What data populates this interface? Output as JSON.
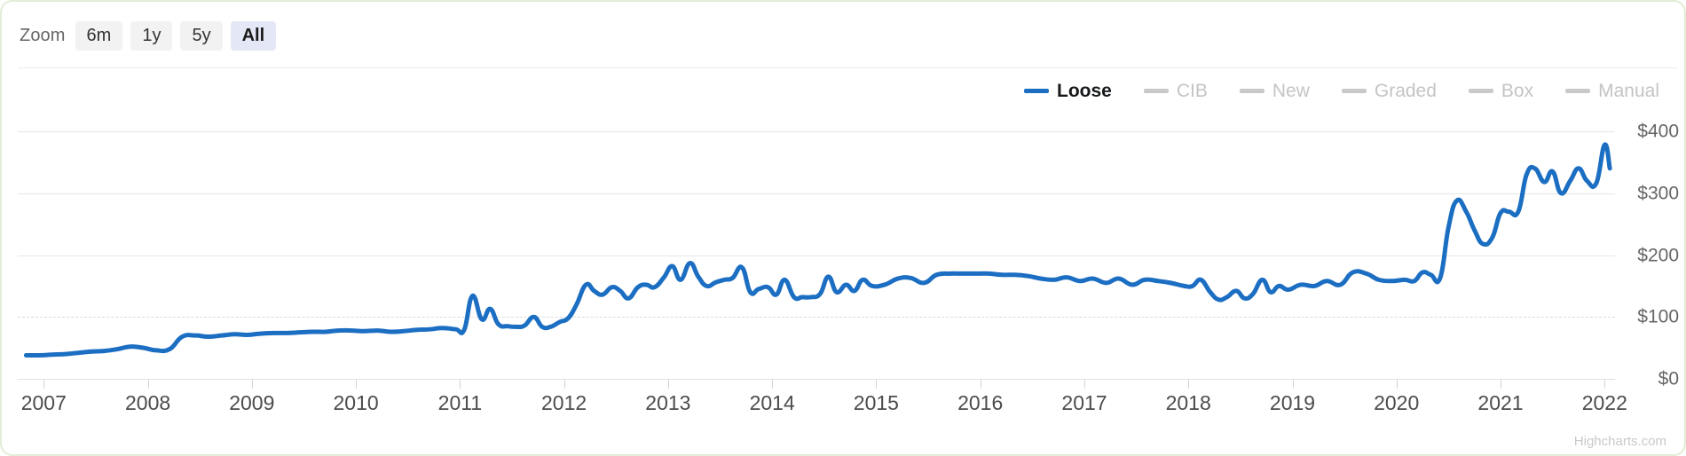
{
  "toolbar": {
    "zoom_label": "Zoom",
    "buttons": [
      {
        "label": "6m",
        "active": false
      },
      {
        "label": "1y",
        "active": false
      },
      {
        "label": "5y",
        "active": false
      },
      {
        "label": "All",
        "active": true
      }
    ]
  },
  "colors": {
    "active_series": "#1b6ec2",
    "inactive_series": "#c9c9c9",
    "grid": "#e6e6e6",
    "frame": "#e3ecd5"
  },
  "credits": "Highcharts.com",
  "chart_data": {
    "type": "line",
    "title": "",
    "subtitle": "",
    "xlabel": "",
    "ylabel": "",
    "grid": true,
    "legend_position": "top-right",
    "xlim": [
      2006.75,
      2022.1
    ],
    "ylim": [
      0,
      430
    ],
    "x_tick_labels": [
      "2007",
      "2008",
      "2009",
      "2010",
      "2011",
      "2012",
      "2013",
      "2014",
      "2015",
      "2016",
      "2017",
      "2018",
      "2019",
      "2020",
      "2021",
      "2022"
    ],
    "x_ticks": [
      2007,
      2008,
      2009,
      2010,
      2011,
      2012,
      2013,
      2014,
      2015,
      2016,
      2017,
      2018,
      2019,
      2020,
      2021,
      2022
    ],
    "y_tick_labels": [
      "$0",
      "$100",
      "$200",
      "$300",
      "$400"
    ],
    "y_ticks": [
      0,
      100,
      200,
      300,
      400
    ],
    "legend": [
      {
        "name": "Loose",
        "color": "#1b6ec2",
        "visible": true
      },
      {
        "name": "CIB",
        "color": "#c9c9c9",
        "visible": false
      },
      {
        "name": "New",
        "color": "#c9c9c9",
        "visible": false
      },
      {
        "name": "Graded",
        "color": "#c9c9c9",
        "visible": false
      },
      {
        "name": "Box",
        "color": "#c9c9c9",
        "visible": false
      },
      {
        "name": "Manual",
        "color": "#c9c9c9",
        "visible": false
      }
    ],
    "series": [
      {
        "name": "Loose",
        "color": "#1b6ec2",
        "x": [
          2006.83,
          2006.96,
          2007.08,
          2007.21,
          2007.33,
          2007.46,
          2007.58,
          2007.71,
          2007.83,
          2007.96,
          2008.08,
          2008.21,
          2008.33,
          2008.46,
          2008.58,
          2008.71,
          2008.83,
          2008.96,
          2009.08,
          2009.21,
          2009.33,
          2009.46,
          2009.58,
          2009.71,
          2009.83,
          2009.96,
          2010.08,
          2010.21,
          2010.33,
          2010.46,
          2010.58,
          2010.71,
          2010.83,
          2010.96,
          2011.04,
          2011.12,
          2011.21,
          2011.29,
          2011.37,
          2011.46,
          2011.54,
          2011.62,
          2011.71,
          2011.79,
          2011.87,
          2011.96,
          2012.04,
          2012.12,
          2012.21,
          2012.29,
          2012.37,
          2012.46,
          2012.54,
          2012.62,
          2012.71,
          2012.79,
          2012.87,
          2012.96,
          2013.04,
          2013.12,
          2013.21,
          2013.29,
          2013.37,
          2013.46,
          2013.54,
          2013.62,
          2013.71,
          2013.79,
          2013.87,
          2013.96,
          2014.04,
          2014.12,
          2014.21,
          2014.29,
          2014.37,
          2014.46,
          2014.54,
          2014.62,
          2014.71,
          2014.79,
          2014.87,
          2014.96,
          2015.08,
          2015.21,
          2015.33,
          2015.46,
          2015.58,
          2015.71,
          2015.83,
          2015.96,
          2016.08,
          2016.21,
          2016.33,
          2016.46,
          2016.58,
          2016.71,
          2016.83,
          2016.96,
          2017.08,
          2017.21,
          2017.33,
          2017.46,
          2017.58,
          2017.71,
          2017.83,
          2017.96,
          2018.04,
          2018.12,
          2018.21,
          2018.29,
          2018.37,
          2018.46,
          2018.54,
          2018.62,
          2018.71,
          2018.79,
          2018.87,
          2018.96,
          2019.08,
          2019.21,
          2019.33,
          2019.46,
          2019.58,
          2019.71,
          2019.83,
          2019.96,
          2020.08,
          2020.17,
          2020.25,
          2020.33,
          2020.42,
          2020.5,
          2020.58,
          2020.67,
          2020.75,
          2020.83,
          2020.92,
          2021.0,
          2021.08,
          2021.17,
          2021.25,
          2021.33,
          2021.42,
          2021.5,
          2021.58,
          2021.67,
          2021.75,
          2021.83,
          2021.92,
          2022.0,
          2022.05
        ],
        "y": [
          38,
          38,
          39,
          40,
          42,
          44,
          45,
          48,
          52,
          50,
          46,
          48,
          68,
          70,
          68,
          70,
          72,
          71,
          73,
          74,
          74,
          75,
          76,
          76,
          78,
          78,
          77,
          78,
          76,
          77,
          79,
          80,
          82,
          80,
          79,
          134,
          96,
          113,
          88,
          85,
          84,
          86,
          100,
          84,
          84,
          92,
          98,
          120,
          152,
          142,
          136,
          148,
          142,
          130,
          148,
          152,
          148,
          164,
          182,
          160,
          187,
          165,
          150,
          156,
          160,
          163,
          180,
          140,
          145,
          148,
          136,
          160,
          132,
          132,
          132,
          137,
          165,
          140,
          152,
          142,
          160,
          150,
          152,
          162,
          163,
          155,
          168,
          170,
          170,
          170,
          170,
          168,
          168,
          166,
          162,
          160,
          164,
          158,
          162,
          155,
          162,
          152,
          160,
          158,
          155,
          150,
          150,
          160,
          140,
          128,
          132,
          142,
          130,
          137,
          160,
          140,
          150,
          144,
          152,
          150,
          158,
          152,
          172,
          170,
          160,
          158,
          160,
          158,
          172,
          168,
          163,
          245,
          288,
          270,
          240,
          218,
          228,
          268,
          270,
          270,
          330,
          340,
          318,
          335,
          300,
          320,
          340,
          320,
          316,
          378,
          340
        ]
      }
    ]
  }
}
